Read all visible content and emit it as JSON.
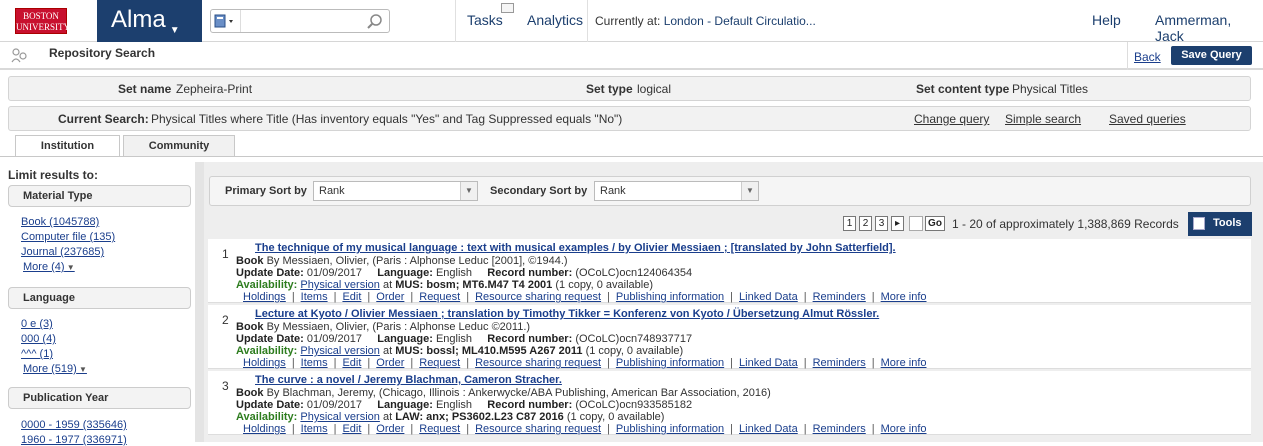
{
  "topbar": {
    "logo_line1": "BOSTON",
    "logo_line2": "UNIVERSITY",
    "app_name": "Alma",
    "search_placeholder": "",
    "tasks": "Tasks",
    "analytics": "Analytics",
    "currently_label": "Currently at:",
    "currently_location": "London - Default Circulatio...",
    "help": "Help",
    "user": "Ammerman, Jack"
  },
  "page": {
    "title": "Repository Search",
    "back": "Back",
    "save_query": "Save Query"
  },
  "set_info": {
    "set_name_label": "Set name",
    "set_name": "Zepheira-Print",
    "set_type_label": "Set type",
    "set_type": "logical",
    "content_type_label": "Set content type",
    "content_type": "Physical Titles"
  },
  "current_search": {
    "label": "Current Search:",
    "value": "Physical Titles where Title (Has inventory equals \"Yes\" and Tag Suppressed equals \"No\")",
    "change_query": "Change query",
    "simple_search": "Simple search",
    "saved_queries": "Saved queries"
  },
  "tabs": [
    "Institution",
    "Community"
  ],
  "facets": {
    "limit_label": "Limit results to:",
    "material_type": {
      "title": "Material Type",
      "items": [
        "Book (1045788)",
        "Computer file (135)",
        "Journal (237685)"
      ],
      "more": "More (4)"
    },
    "language": {
      "title": "Language",
      "items": [
        "0 e (3)",
        "000 (4)",
        "^^^ (1)"
      ],
      "more": "More (519)"
    },
    "publication_year": {
      "title": "Publication Year",
      "items": [
        "0000 - 1959 (335646)",
        "1960 - 1977 (336971)"
      ]
    }
  },
  "sort": {
    "primary_label": "Primary Sort by",
    "primary_value": "Rank",
    "secondary_label": "Secondary Sort by",
    "secondary_value": "Rank"
  },
  "pagination": {
    "pages": [
      "1",
      "2",
      "3"
    ],
    "next": "▸",
    "go": "Go",
    "record_count": "1 - 20 of approximately 1,388,869 Records",
    "tools": "Tools"
  },
  "labels": {
    "book": "Book",
    "by": "By",
    "update_date": "Update Date:",
    "language": "Language:",
    "record_number": "Record number:",
    "availability": "Availability:",
    "physical_version": "Physical version",
    "at": "at"
  },
  "actions": [
    "Holdings",
    "Items",
    "Edit",
    "Order",
    "Request",
    "Resource sharing request",
    "Publishing information",
    "Linked Data",
    "Reminders",
    "More info"
  ],
  "results": [
    {
      "num": "1",
      "title": "The technique of my musical language : text with musical examples / by Olivier Messiaen ; [translated by John Satterfield].",
      "author": "Messiaen, Olivier,",
      "pub": "(Paris : Alphonse Leduc [2001], ©1944.)",
      "update_date": "01/09/2017",
      "language": "English",
      "record_number": "(OCoLC)ocn124064354",
      "location": "MUS: bosm; MT6.M47 T4 2001",
      "copies": "(1 copy, 0 available)"
    },
    {
      "num": "2",
      "title": "Lecture at Kyoto / Olivier Messiaen ; translation by Timothy Tikker = Konferenz von Kyoto / Übersetzung Almut Rössler.",
      "author": "Messiaen, Olivier,",
      "pub": "(Paris : Alphonse Leduc ©2011.)",
      "update_date": "01/09/2017",
      "language": "English",
      "record_number": "(OCoLC)ocn748937717",
      "location": "MUS: bossl; ML410.M595 A267 2011",
      "copies": "(1 copy, 0 available)"
    },
    {
      "num": "3",
      "title": "The curve : a novel / Jeremy Blachman, Cameron Stracher.",
      "author": "Blachman, Jeremy,",
      "pub": "(Chicago, Illinois : Ankerwycke/ABA Publishing, American Bar Association, 2016)",
      "update_date": "01/09/2017",
      "language": "English",
      "record_number": "(OCoLC)ocn933585182",
      "location": "LAW: anx; PS3602.L23 C87 2016",
      "copies": "(1 copy, 0 available)"
    }
  ]
}
